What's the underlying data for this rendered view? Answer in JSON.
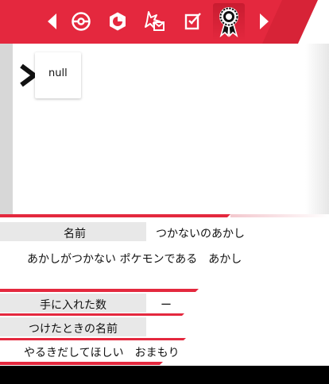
{
  "toolbar": {
    "items": [
      {
        "name": "prev-arrow-icon"
      },
      {
        "name": "poke-ball-icon"
      },
      {
        "name": "hexagon-badge-icon"
      },
      {
        "name": "mail-burst-icon"
      },
      {
        "name": "memo-check-icon"
      },
      {
        "name": "ribbon-medal-icon"
      },
      {
        "name": "next-arrow-icon"
      }
    ],
    "active": "ribbon-medal-icon"
  },
  "list": {
    "cursor_icon": "chevron-right-icon",
    "items": [
      {
        "label": "null"
      }
    ]
  },
  "detail": {
    "name_label": "名前",
    "name_value": "つかないのあかし",
    "description": "あかしがつかない ポケモンである　あかし",
    "obtained_label": "手に入れた数",
    "obtained_value": "ー",
    "title_label": "つけたときの名前",
    "title_value": "やるきだしてほしい　おまもり"
  },
  "colors": {
    "accent": "#e4283e",
    "row_bg": "#e8e8e8",
    "rail": "#d7d7d7"
  }
}
